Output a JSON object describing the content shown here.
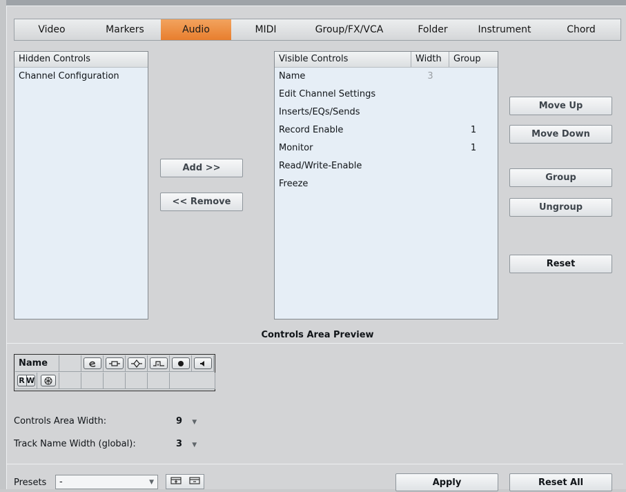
{
  "tabs": [
    {
      "label": "Video",
      "active": false
    },
    {
      "label": "Markers",
      "active": false
    },
    {
      "label": "Audio",
      "active": true
    },
    {
      "label": "MIDI",
      "active": false
    },
    {
      "label": "Group/FX/VCA",
      "active": false
    },
    {
      "label": "Folder",
      "active": false
    },
    {
      "label": "Instrument",
      "active": false
    },
    {
      "label": "Chord",
      "active": false
    }
  ],
  "hidden_controls": {
    "header": "Hidden Controls",
    "items": [
      "Channel Configuration"
    ]
  },
  "transfer": {
    "add": "Add >>",
    "remove": "<< Remove"
  },
  "visible_controls": {
    "headers": {
      "name": "Visible Controls",
      "width": "Width",
      "group": "Group"
    },
    "rows": [
      {
        "name": "Name",
        "width": "3",
        "group": ""
      },
      {
        "name": "Edit Channel Settings",
        "width": "",
        "group": ""
      },
      {
        "name": "Inserts/EQs/Sends",
        "width": "",
        "group": ""
      },
      {
        "name": "Record Enable",
        "width": "",
        "group": "1"
      },
      {
        "name": "Monitor",
        "width": "",
        "group": "1"
      },
      {
        "name": "Read/Write-Enable",
        "width": "",
        "group": ""
      },
      {
        "name": "Freeze",
        "width": "",
        "group": ""
      }
    ]
  },
  "side_buttons": {
    "move_up": "Move Up",
    "move_down": "Move Down",
    "group": "Group",
    "ungroup": "Ungroup",
    "reset": "Reset"
  },
  "preview": {
    "title": "Controls Area Preview",
    "name_label": "Name",
    "r_label": "R",
    "w_label": "W",
    "icons": [
      "edit-channel-icon",
      "inserts-icon",
      "eq-icon",
      "sends-icon",
      "record-enable-icon",
      "monitor-icon",
      "freeze-icon"
    ]
  },
  "settings": {
    "controls_area_width_label": "Controls Area Width:",
    "controls_area_width_value": "9",
    "track_name_width_label": "Track Name Width (global):",
    "track_name_width_value": "3"
  },
  "footer": {
    "presets_label": "Presets",
    "presets_value": "-",
    "apply": "Apply",
    "reset_all": "Reset All"
  },
  "colors": {
    "active_tab": "#e87e2e",
    "list_bg": "#e6eef6",
    "panel_bg": "#d3d4d6"
  }
}
